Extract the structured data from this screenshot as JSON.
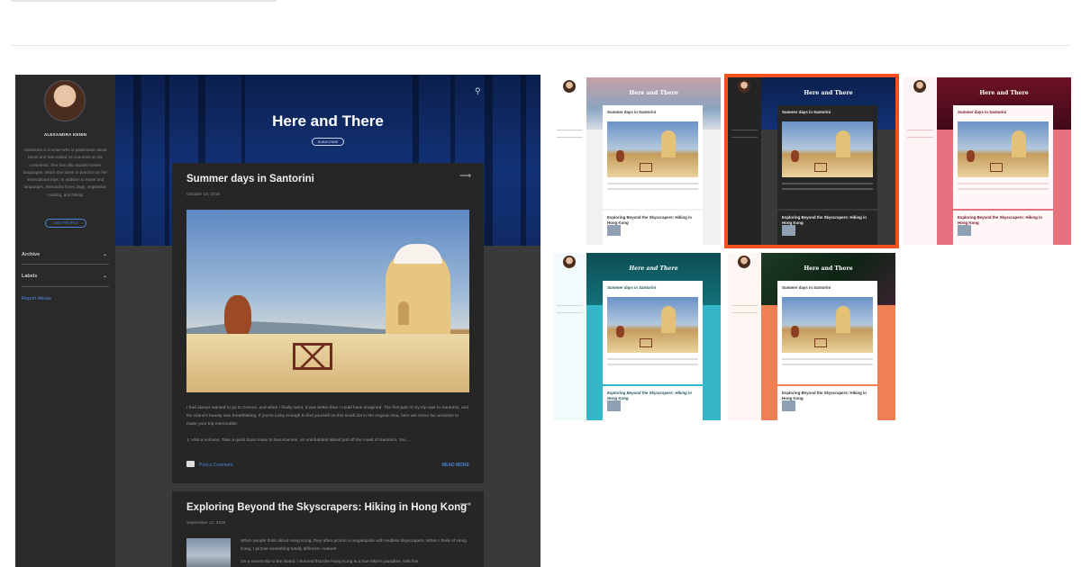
{
  "preview": {
    "blog_title": "Here and There",
    "subscribe": "SUBSCRIBE",
    "search_icon": "search-icon",
    "sidebar": {
      "author": "ALEXANDRA KENIN",
      "bio": "Alexandra is a writer who is passionate about travel and has visited 46 countries on six continents. She has also studied seven languages, which she loves to practice on her international trips. In addition to travel and languages, Alexandra loves dogs, vegetarian cooking, and hiking.",
      "visit_profile": "VISIT PROFILE",
      "archive": "Archive",
      "labels": "Labels",
      "report_abuse": "Report Abuse"
    },
    "post1": {
      "title": "Summer days in Santorini",
      "date": "October 18, 2016",
      "paragraph1": "I had always wanted to go to Greece, and when I finally went, it was better than I could have imagined. The first part of my trip was to Santorini, and the island's beauty was breathtaking. If you're lucky enough to find yourself on this small dot in the Aegean Sea, here are some fun activities to make your trip memorable:",
      "paragraph2": "1. Visit a volcano. Take a quick boat cruise to Nea Kameni, an uninhabited island just off the coast of Santorini. You ...",
      "comment": "Post a Comment",
      "read_more": "READ MORE"
    },
    "post2": {
      "title": "Exploring Beyond the Skyscrapers: Hiking in Hong Kong",
      "date": "September 12, 2016",
      "paragraph1": "When people think about Hong Kong, they often picture a megalopolis with endless skyscrapers. When I think of Hong Kong, I picture something totally different—nature!",
      "paragraph2": "On a recent trip to the island, I learned that the Hong Kong is a true hiker's paradise, with five"
    }
  },
  "themes": [
    {
      "id": "light",
      "title": "Here and There",
      "post1": "Summer days in Santorini",
      "post2": "Exploring Beyond the Skyscrapers: Hiking in Hong Kong",
      "selected": false
    },
    {
      "id": "dark",
      "title": "Here and There",
      "post1": "Summer days in Santorini",
      "post2": "Exploring Beyond the Skyscrapers: Hiking in Hong Kong",
      "selected": true
    },
    {
      "id": "pink",
      "title": "Here and There",
      "post1": "Summer days in Santorini",
      "post2": "Exploring Beyond the Skyscrapers: Hiking in Hong Kong",
      "selected": false
    },
    {
      "id": "teal",
      "title": "Here and There",
      "post1": "Summer days in Santorini",
      "post2": "Exploring Beyond the Skyscrapers: Hiking in Hong Kong",
      "selected": false
    },
    {
      "id": "tropical",
      "title": "Here and There",
      "post1": "Summer days in Santorini",
      "post2": "Exploring Beyond the Skyscrapers: Hiking in Hong Kong",
      "selected": false
    }
  ],
  "colors": {
    "selection_outline": "#f4511e",
    "link_blue": "#4a86d8"
  }
}
